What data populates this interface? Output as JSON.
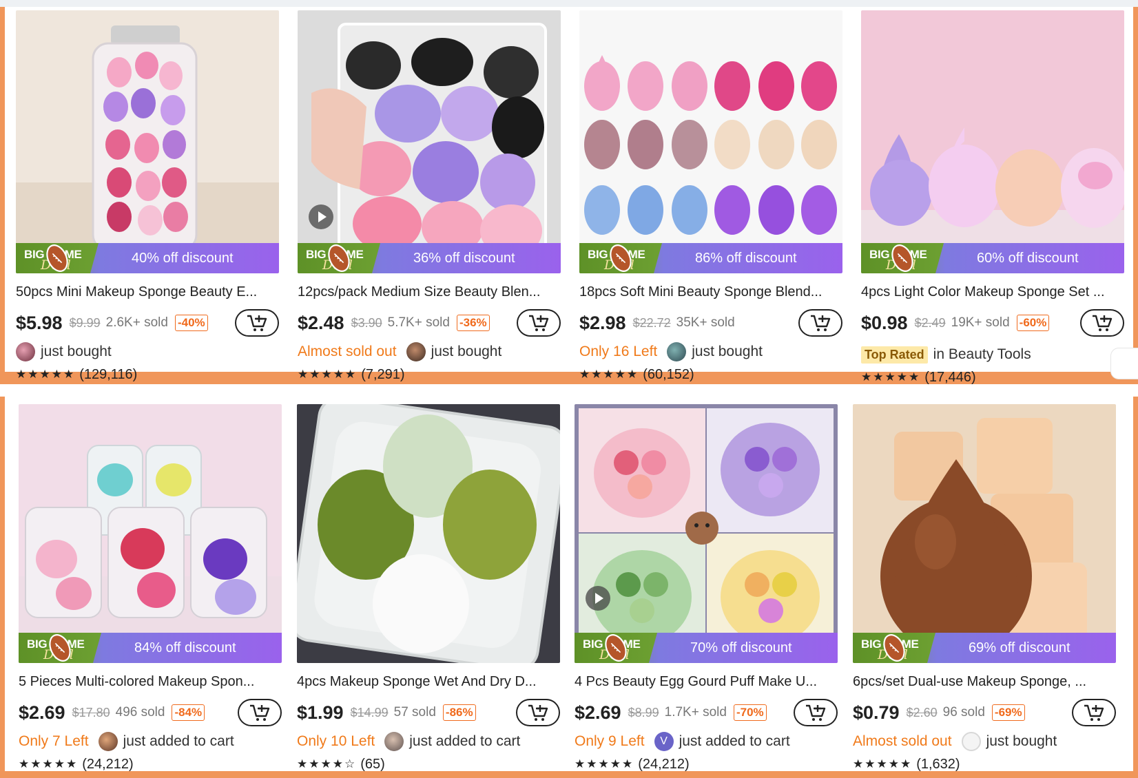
{
  "colors": {
    "frame": "#f0965a",
    "urgent": "#f07a1a",
    "discount": "#f06a1c",
    "deal_start": "#6c9a2c",
    "deal_end": "#9a62ec",
    "top_rated_bg": "#fde9a8"
  },
  "deal_brand": {
    "line1": "BIG GAME",
    "line2": "Deal"
  },
  "products": [
    {
      "deal": "40% off discount",
      "title": "50pcs Mini Makeup Sponge Beauty E...",
      "price": "$5.98",
      "orig": "$9.99",
      "sold": "2.6K+ sold",
      "disc": "-40%",
      "urgent": "",
      "who": "just bought",
      "rating": "(129,116)",
      "stars": "★★★★★"
    },
    {
      "deal": "36% off discount",
      "title": "12pcs/pack Medium Size Beauty Blen...",
      "price": "$2.48",
      "orig": "$3.90",
      "sold": "5.7K+ sold",
      "disc": "-36%",
      "urgent": "Almost sold out",
      "who": "just bought",
      "rating": "(7,291)",
      "stars": "★★★★★"
    },
    {
      "deal": "86% off discount",
      "title": "18pcs Soft Mini Beauty Sponge Blend...",
      "price": "$2.98",
      "orig": "$22.72",
      "sold": "35K+ sold",
      "disc": "",
      "urgent": "Only 16 Left",
      "who": "just bought",
      "rating": "(60,152)",
      "stars": "★★★★★"
    },
    {
      "deal": "60% off discount",
      "title": "4pcs Light Color Makeup Sponge Set ...",
      "price": "$0.98",
      "orig": "$2.49",
      "sold": "19K+ sold",
      "disc": "-60%",
      "badge": "Top Rated",
      "badge_tail": "in Beauty Tools",
      "rating": "(17,446)",
      "stars": "★★★★★"
    },
    {
      "deal": "84% off discount",
      "title": "5 Pieces Multi-colored Makeup Spon...",
      "price": "$2.69",
      "orig": "$17.80",
      "sold": "496 sold",
      "disc": "-84%",
      "urgent": "Only 7 Left",
      "who": "just added to cart",
      "rating": "(24,212)",
      "stars": "★★★★★"
    },
    {
      "deal": "",
      "title": "4pcs Makeup Sponge Wet And Dry D...",
      "price": "$1.99",
      "orig": "$14.99",
      "sold": "57 sold",
      "disc": "-86%",
      "urgent": "Only 10 Left",
      "who": "just added to cart",
      "rating": "(65)",
      "stars": "★★★★☆"
    },
    {
      "deal": "70% off discount",
      "title": "4 Pcs Beauty Egg Gourd Puff Make U...",
      "price": "$2.69",
      "orig": "$8.99",
      "sold": "1.7K+ sold",
      "disc": "-70%",
      "urgent": "Only 9 Left",
      "who": "just added to cart",
      "avatar_letter": "V",
      "rating": "(24,212)",
      "stars": "★★★★★"
    },
    {
      "deal": "69% off discount",
      "title": "6pcs/set Dual-use Makeup Sponge, ...",
      "price": "$0.79",
      "orig": "$2.60",
      "sold": "96 sold",
      "disc": "-69%",
      "urgent": "Almost sold out",
      "who": "just bought",
      "rating": "(1,632)",
      "stars": "★★★★★"
    }
  ]
}
